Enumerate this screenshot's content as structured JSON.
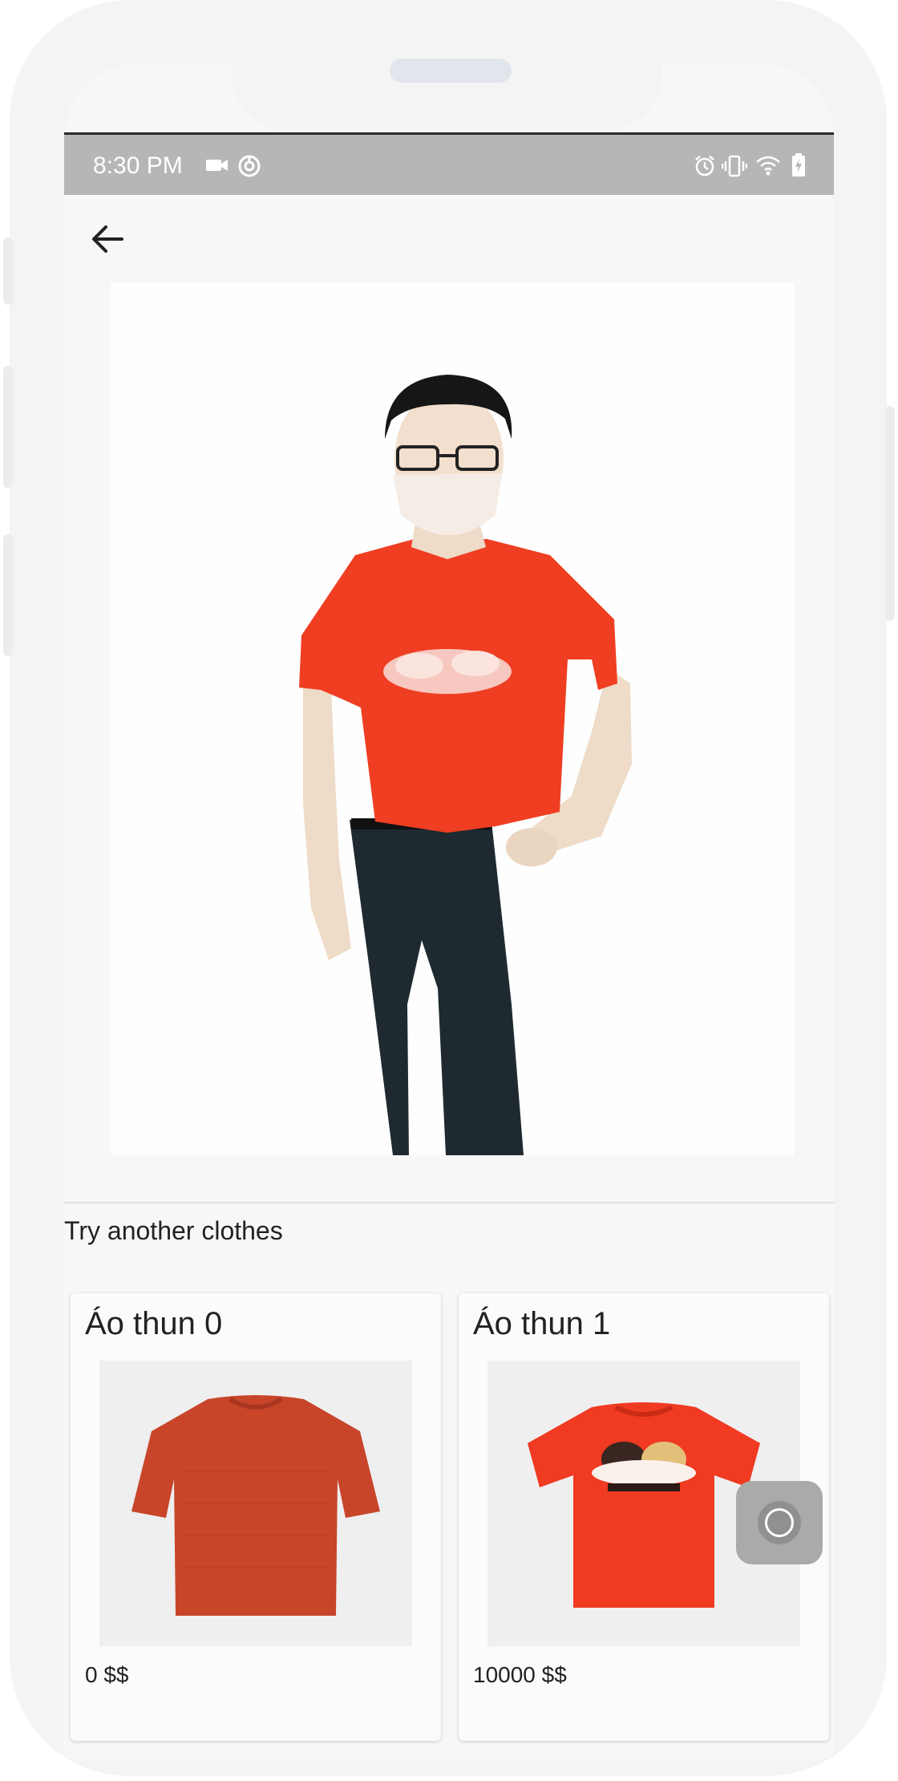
{
  "status_bar": {
    "time": "8:30 PM",
    "left_icons": [
      "video-camera-icon",
      "sync-circle-icon"
    ],
    "right_icons": [
      "alarm-icon",
      "vibrate-icon",
      "wifi-icon",
      "battery-charging-icon"
    ]
  },
  "header": {
    "back_icon": "arrow-left-icon"
  },
  "result_photo": {
    "icon": "person-wearing-red-tshirt-image"
  },
  "section": {
    "title": "Try another clothes"
  },
  "products": [
    {
      "name": "Áo thun 0",
      "price": "0 $$",
      "image": "rust-knit-tshirt-image",
      "color": "#c8452a"
    },
    {
      "name": "Áo thun 1",
      "price": "10000 $$",
      "image": "red-print-tshirt-image",
      "color": "#f03a22"
    }
  ],
  "fab": {
    "icon": "circle-button-icon"
  },
  "colors": {
    "status_bar_bg": "#b6b7b5",
    "screen_bg": "#f6f7f6",
    "frame": "#f4f4f4"
  }
}
